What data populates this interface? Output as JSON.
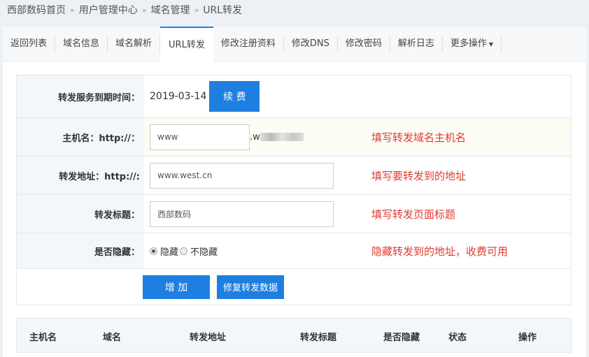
{
  "breadcrumb": [
    "西部数码首页",
    "用户管理中心",
    "域名管理",
    "URL转发"
  ],
  "breadcrumb_sep": "»",
  "tabs": [
    "返回列表",
    "域名信息",
    "域名解析",
    "URL转发",
    "修改注册资料",
    "修改DNS",
    "修改密码",
    "解析日志",
    "更多操作"
  ],
  "form": {
    "expire_label": "转发服务到期时间：",
    "expire_date": "2019-03-14",
    "renew_button": "续 费",
    "host_label": "主机名：http://：",
    "host_value": "www",
    "domain_suffix": ".w",
    "host_hint": "填写转发域名主机名",
    "url_label": "转发地址：http://:",
    "url_value": "www.west.cn",
    "url_hint": "填写要转发到的地址",
    "title_label": "转发标题：",
    "title_value": "西部数码",
    "title_hint": "填写转发页面标题",
    "hide_label": "是否隐藏：",
    "hide_yes": "隐藏",
    "hide_no": "不隐藏",
    "hide_hint": "隐藏转发到的地址，收费可用",
    "add_button": "增 加",
    "repair_button": "修复转发数据"
  },
  "table_headers": [
    "主机名",
    "域名",
    "转发地址",
    "转发标题",
    "是否隐藏",
    "状态",
    "操作"
  ]
}
